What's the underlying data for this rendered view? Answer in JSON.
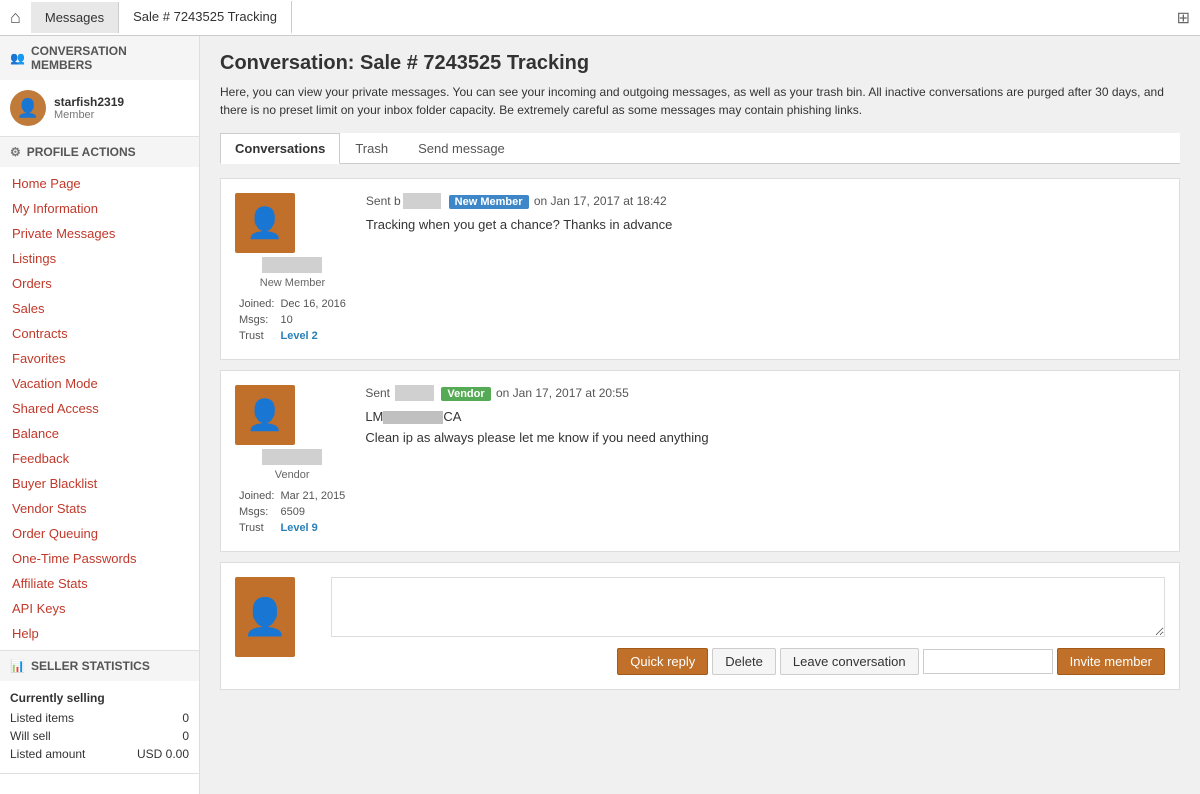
{
  "topNav": {
    "homeIcon": "⌂",
    "breadcrumbs": [
      {
        "label": "Messages",
        "active": false
      },
      {
        "label": "Sale # 7243525 Tracking",
        "active": true
      }
    ],
    "rightIcon": "⊞"
  },
  "sidebar": {
    "conversationMembers": {
      "header": "CONVERSATION MEMBERS",
      "user": {
        "name": "starfish2319",
        "role": "Member"
      }
    },
    "profileActions": {
      "header": "PROFILE ACTIONS",
      "items": [
        "Home Page",
        "My Information",
        "Private Messages",
        "Listings",
        "Orders",
        "Sales",
        "Contracts",
        "Favorites",
        "Vacation Mode",
        "Shared Access",
        "Balance",
        "Feedback",
        "Buyer Blacklist",
        "Vendor Stats",
        "Order Queuing",
        "One-Time Passwords",
        "Affiliate Stats",
        "API Keys",
        "Help"
      ]
    },
    "sellerStats": {
      "header": "SELLER STATISTICS",
      "currentlySelling": "Currently selling",
      "stats": [
        {
          "label": "Listed items",
          "value": "0"
        },
        {
          "label": "Will sell",
          "value": "0"
        },
        {
          "label": "Listed amount",
          "value": "USD 0.00"
        }
      ]
    }
  },
  "main": {
    "title": "Conversation: Sale # 7243525 Tracking",
    "infoText": "Here, you can view your private messages. You can see your incoming and outgoing messages, as well as your trash bin. All inactive conversations are purged after 30 days, and there is no preset limit on your inbox folder capacity. Be extremely careful as some messages may contain phishing links.",
    "tabs": [
      {
        "label": "Conversations",
        "active": true
      },
      {
        "label": "Trash",
        "active": false
      },
      {
        "label": "Send message",
        "active": false
      }
    ],
    "messages": [
      {
        "id": "msg1",
        "avatarColor": "#c0702a",
        "memberLabel": "New Member",
        "senderNameRedacted": true,
        "badge": "New Member",
        "badgeClass": "badge-new-member",
        "timestamp": "on Jan 17, 2017 at 18:42",
        "text": "Tracking when you get a chance? Thanks in advance",
        "joined": "Dec 16, 2016",
        "msgs": "10",
        "trust": "Level 2",
        "trustClass": "trust-level"
      },
      {
        "id": "msg2",
        "avatarColor": "#c0702a",
        "memberLabel": "Vendor",
        "senderNameRedacted": true,
        "badge": "Vendor",
        "badgeClass": "badge-vendor",
        "timestamp": "on Jan 17, 2017 at 20:55",
        "text": "Clean ip as always please let me know if you need anything",
        "locationRedacted": true,
        "joined": "Mar 21, 2015",
        "msgs": "6509",
        "trust": "Level 9",
        "trustClass": "trust-level"
      }
    ],
    "replyArea": {
      "placeholder": "",
      "buttons": {
        "quickReply": "Quick reply",
        "delete": "Delete",
        "leaveConversation": "Leave conversation",
        "invitePlaceholder": "",
        "inviteMember": "Invite member"
      }
    }
  }
}
